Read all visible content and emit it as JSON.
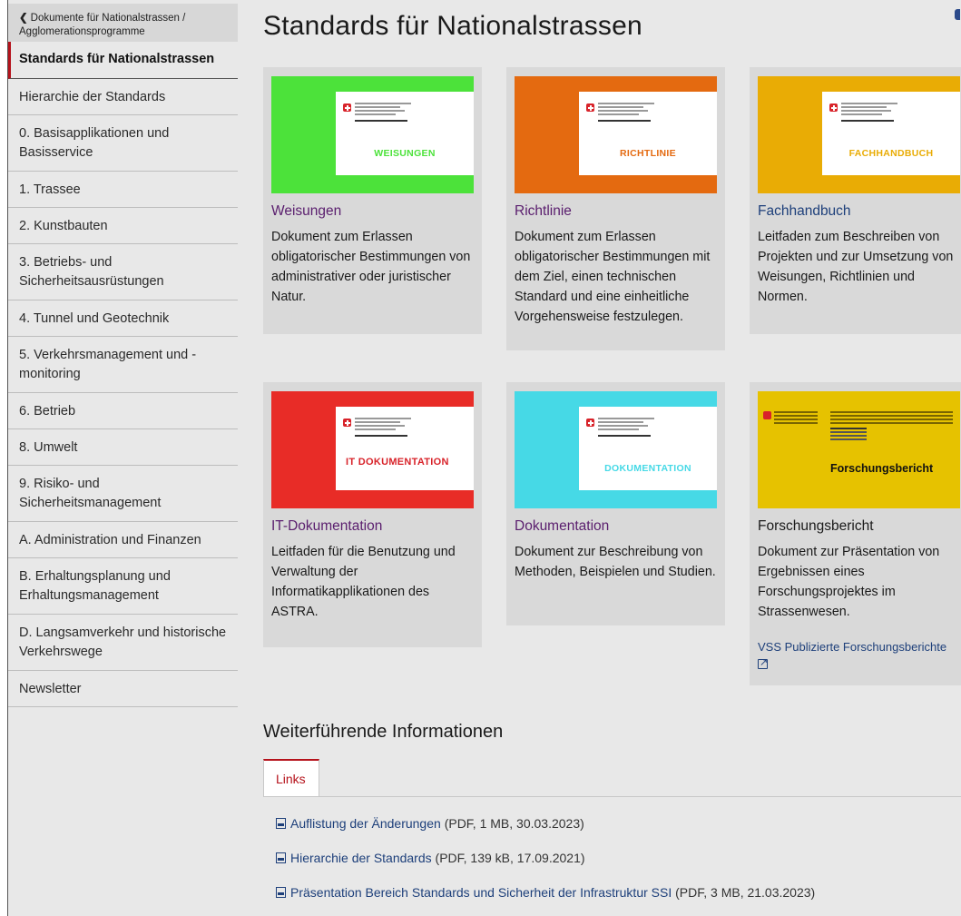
{
  "sidebar": {
    "back_link": "Dokumente für Nationalstrassen / Agglomerationsprogramme",
    "items": [
      {
        "label": "Standards für Nationalstrassen",
        "active": true
      },
      {
        "label": "Hierarchie der Standards"
      },
      {
        "label": "0. Basisapplikationen und Basisservice"
      },
      {
        "label": "1. Trassee"
      },
      {
        "label": "2. Kunstbauten"
      },
      {
        "label": "3. Betriebs- und Sicherheitsausrüstungen"
      },
      {
        "label": "4. Tunnel und Geotechnik"
      },
      {
        "label": "5. Verkehrsmanagement und -monitoring"
      },
      {
        "label": "6. Betrieb"
      },
      {
        "label": "8. Umwelt"
      },
      {
        "label": "9. Risiko- und Sicherheitsmanagement"
      },
      {
        "label": "A. Administration und Finanzen"
      },
      {
        "label": "B. Erhaltungsplanung und Erhaltungsmanagement"
      },
      {
        "label": "D. Langsamverkehr und historische Verkehrswege"
      },
      {
        "label": "Newsletter"
      }
    ]
  },
  "page_title": "Standards für Nationalstrassen",
  "cards": [
    {
      "title": "Weisungen",
      "cover_label": "WEISUNGEN",
      "color": "#4ce23a",
      "label_color": "#4ce23a",
      "title_color": "#5a1e6e",
      "description": "Dokument zum Erlassen obligatorischer Bestimmungen von administrativer oder juristischer Natur."
    },
    {
      "title": "Richtlinie",
      "cover_label": "RICHTLINIE",
      "color": "#e46a10",
      "label_color": "#e46a10",
      "title_color": "#5a1e6e",
      "description": "Dokument zum Erlassen obligatorischer Bestimmungen mit dem Ziel, einen technischen Standard und eine einheitliche Vorgehensweise festzulegen."
    },
    {
      "title": "Fachhandbuch",
      "cover_label": "FACHHANDBUCH",
      "color": "#e9ac05",
      "label_color": "#e9ac05",
      "title_color": "#1d3f7a",
      "description": "Leitfaden zum Beschreiben von Projekten und zur Umsetzung von Weisungen, Richtlinien und Normen."
    },
    {
      "title": "IT-Dokumentation",
      "cover_label": "IT DOKUMENTATION",
      "color": "#e82c27",
      "label_color": "#d8232a",
      "title_color": "#5a1e6e",
      "description": "Leitfaden für die Benutzung und Verwaltung der Informatikapplikationen des ASTRA."
    },
    {
      "title": "Dokumentation",
      "cover_label": "DOKUMENTATION",
      "color": "#46d9e6",
      "label_color": "#46d9e6",
      "title_color": "#5a1e6e",
      "description": "Dokument zur Beschreibung von Methoden, Beispielen und Studien."
    },
    {
      "title": "Forschungsbericht",
      "cover_label": "Forschungsbericht",
      "color": "#e6c200",
      "label_color": "#111111",
      "title_color": "#1a1a1a",
      "description": "Dokument zur Präsentation von Ergebnissen eines Forschungsprojektes im Strassenwesen.",
      "extra_link": "VSS Publizierte Forschungsberichte"
    }
  ],
  "further": {
    "title": "Weiterführende Informationen",
    "tab": "Links",
    "links": [
      {
        "text": "Auflistung der Änderungen",
        "meta": "(PDF, 1 MB, 30.03.2023)"
      },
      {
        "text": "Hierarchie der Standards",
        "meta": "(PDF, 139 kB, 17.09.2021)"
      },
      {
        "text": "Präsentation Bereich Standards und Sicherheit der Infrastruktur SSI",
        "meta": "(PDF, 3 MB, 21.03.2023)"
      }
    ]
  }
}
